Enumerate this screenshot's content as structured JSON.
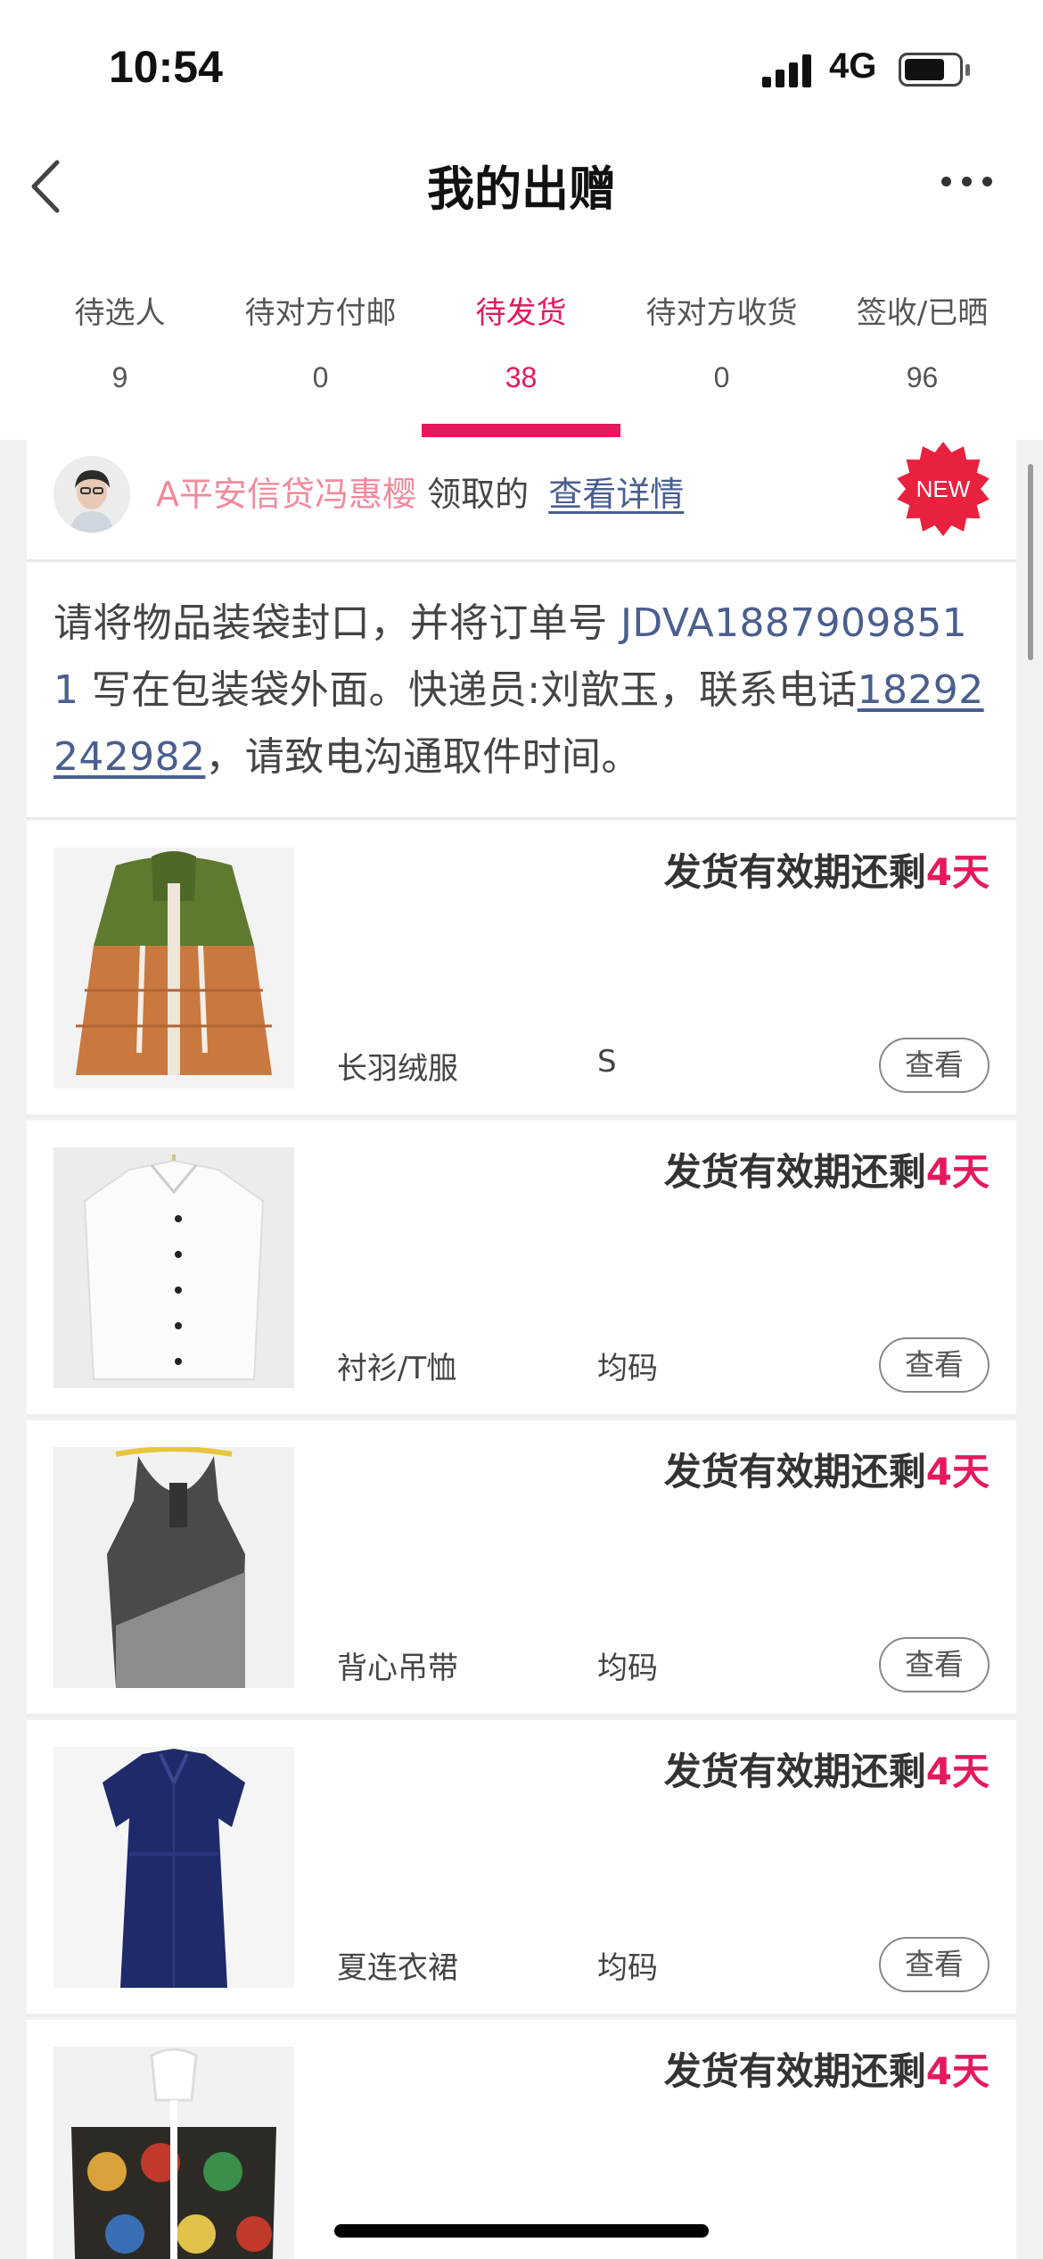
{
  "status_bar": {
    "time": "10:54",
    "network": "4G",
    "battery_level": 0.75
  },
  "header": {
    "title": "我的出赠"
  },
  "tabs": [
    {
      "label": "待选人",
      "count": "9",
      "active": false
    },
    {
      "label": "待对方付邮",
      "count": "0",
      "active": false
    },
    {
      "label": "待发货",
      "count": "38",
      "active": true
    },
    {
      "label": "待对方收货",
      "count": "0",
      "active": false
    },
    {
      "label": "签收/已晒",
      "count": "96",
      "active": false
    }
  ],
  "giver": {
    "name": "A平安信贷冯惠樱",
    "verb": "领取的",
    "detail_link": "查看详情",
    "badge": "NEW"
  },
  "notice": {
    "p1": "请将物品装袋封口，并将订单号",
    "order_no": "JDVA18879098511",
    "p2": "写在包装袋外面。快递员:刘歆玉，联系电话",
    "phone": "18292242982",
    "p3": "，请致电沟通取件时间。"
  },
  "items": [
    {
      "deadline_prefix": "发货有效期还剩",
      "deadline_days": "4天",
      "name": "长羽绒服",
      "size": "S",
      "view_label": "查看",
      "thumb": "coat-photo"
    },
    {
      "deadline_prefix": "发货有效期还剩",
      "deadline_days": "4天",
      "name": "衬衫/T恤",
      "size": "均码",
      "view_label": "查看",
      "thumb": "shirt-photo"
    },
    {
      "deadline_prefix": "发货有效期还剩",
      "deadline_days": "4天",
      "name": "背心吊带",
      "size": "均码",
      "view_label": "查看",
      "thumb": "tank-top-photo"
    },
    {
      "deadline_prefix": "发货有效期还剩",
      "deadline_days": "4天",
      "name": "夏连衣裙",
      "size": "均码",
      "view_label": "查看",
      "thumb": "dress-photo"
    },
    {
      "deadline_prefix": "发货有效期还剩",
      "deadline_days": "4天",
      "name": "",
      "size": "",
      "view_label": "",
      "thumb": "shorts-photo"
    }
  ],
  "colors": {
    "accent": "#e5195c",
    "link": "#4a5e8f",
    "giver_name": "#f08a9d"
  }
}
